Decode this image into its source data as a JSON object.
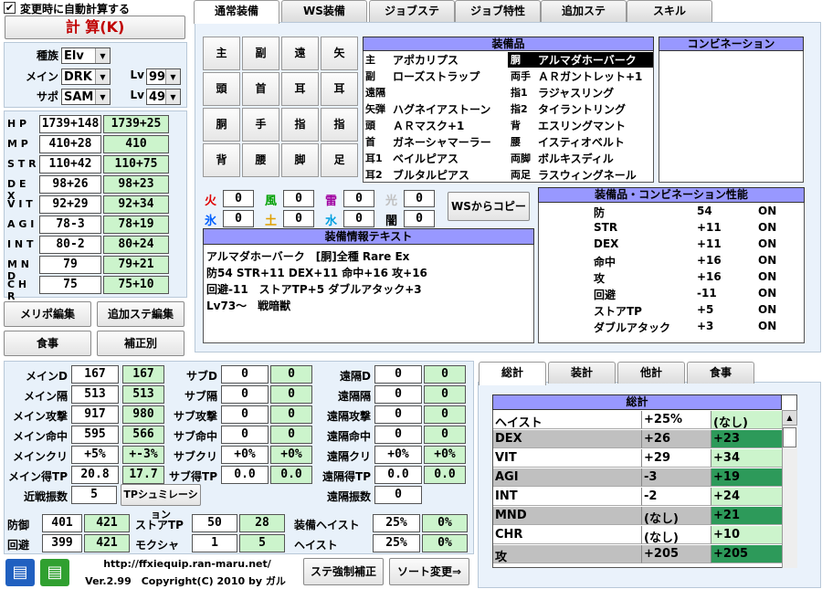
{
  "top": {
    "auto_calc_label": "変更時に自動計算する",
    "calc_button": "計 算(K)"
  },
  "race": {
    "label": "種族",
    "value": "Elv",
    "main_label": "メイン",
    "main_value": "DRK",
    "main_lv_label": "Lv",
    "main_lv": "99",
    "sub_label": "サポ",
    "sub_value": "SAM",
    "sub_lv_label": "Lv",
    "sub_lv": "49"
  },
  "stats": [
    {
      "name": "H P",
      "base": "1739+148",
      "total": "1739+25"
    },
    {
      "name": "M P",
      "base": "410+28",
      "total": "410"
    },
    {
      "name": "S T R",
      "base": "110+42",
      "total": "110+75"
    },
    {
      "name": "D E X",
      "base": "98+26",
      "total": "98+23"
    },
    {
      "name": "V I T",
      "base": "92+29",
      "total": "92+34"
    },
    {
      "name": "A G I",
      "base": "78-3",
      "total": "78+19"
    },
    {
      "name": "I N T",
      "base": "80-2",
      "total": "80+24"
    },
    {
      "name": "M N D",
      "base": "79",
      "total": "79+21"
    },
    {
      "name": "C H R",
      "base": "75",
      "total": "75+10"
    }
  ],
  "left_buttons": {
    "merit": "メリポ編集",
    "extra_stats": "追加ステ編集",
    "food": "食事",
    "correction": "補正別"
  },
  "tabs": [
    "通常装備",
    "WS装備",
    "ジョブステ",
    "ジョブ特性",
    "追加ステ",
    "スキル"
  ],
  "slots": [
    [
      "主",
      "副",
      "遠",
      "矢"
    ],
    [
      "頭",
      "首",
      "耳",
      "耳"
    ],
    [
      "胴",
      "手",
      "指",
      "指"
    ],
    [
      "背",
      "腰",
      "脚",
      "足"
    ]
  ],
  "equipment": {
    "header": "装備品",
    "left": [
      {
        "slot": "主",
        "name": "アポカリプス"
      },
      {
        "slot": "副",
        "name": "ローズストラップ"
      },
      {
        "slot": "遠隔",
        "name": ""
      },
      {
        "slot": "矢弾",
        "name": "ハグネイアストーン"
      },
      {
        "slot": "頭",
        "name": "ＡＲマスク+1"
      },
      {
        "slot": "首",
        "name": "ガネーシャマーラー"
      },
      {
        "slot": "耳1",
        "name": "ベイルピアス"
      },
      {
        "slot": "耳2",
        "name": "ブルタルピアス"
      }
    ],
    "right": [
      {
        "slot": "胴",
        "name": "アルマダホーバーク"
      },
      {
        "slot": "両手",
        "name": "ＡＲガントレット+1"
      },
      {
        "slot": "指1",
        "name": "ラジャスリング"
      },
      {
        "slot": "指2",
        "name": "タイラントリング"
      },
      {
        "slot": "背",
        "name": "エスリングマント"
      },
      {
        "slot": "腰",
        "name": "イスティオベルト"
      },
      {
        "slot": "両脚",
        "name": "ボルキスディル"
      },
      {
        "slot": "両足",
        "name": "ラスウィングネール"
      }
    ]
  },
  "combination": {
    "header": "コンビネーション"
  },
  "elements": [
    {
      "name": "火",
      "value": "0",
      "color": "#e00000"
    },
    {
      "name": "風",
      "value": "0",
      "color": "#00a000"
    },
    {
      "name": "雷",
      "value": "0",
      "color": "#a000a0"
    },
    {
      "name": "光",
      "value": "0",
      "color": "#c0c0c0"
    },
    {
      "name": "氷",
      "value": "0",
      "color": "#0060ff"
    },
    {
      "name": "土",
      "value": "0",
      "color": "#e0a000"
    },
    {
      "name": "水",
      "value": "0",
      "color": "#00a0e0"
    },
    {
      "name": "闇",
      "value": "0",
      "color": "#000000"
    }
  ],
  "ws_copy": "WSからコピー",
  "equip_text": {
    "header": "装備情報テキスト",
    "lines": [
      "アルマダホーバーク　[胴]全種 Rare Ex",
      "防54 STR+11 DEX+11 命中+16 攻+16",
      "回避-11　ストアTP+5 ダブルアタック+3",
      "Lv73～　戦暗獣"
    ]
  },
  "perf": {
    "header": "装備品・コンビネーション性能",
    "rows": [
      {
        "name": "防",
        "value": "54",
        "state": "ON"
      },
      {
        "name": "STR",
        "value": "+11",
        "state": "ON"
      },
      {
        "name": "DEX",
        "value": "+11",
        "state": "ON"
      },
      {
        "name": "命中",
        "value": "+16",
        "state": "ON"
      },
      {
        "name": "攻",
        "value": "+16",
        "state": "ON"
      },
      {
        "name": "回避",
        "value": "-11",
        "state": "ON"
      },
      {
        "name": "ストアTP",
        "value": "+5",
        "state": "ON"
      },
      {
        "name": "ダブルアタック",
        "value": "+3",
        "state": "ON"
      }
    ]
  },
  "battle": {
    "main": [
      {
        "label": "メインD",
        "a": "167",
        "b": "167"
      },
      {
        "label": "メイン隔",
        "a": "513",
        "b": "513"
      },
      {
        "label": "メイン攻撃",
        "a": "917",
        "b": "980"
      },
      {
        "label": "メイン命中",
        "a": "595",
        "b": "566"
      },
      {
        "label": "メインクリ",
        "a": "+5%",
        "b": "+-3%"
      },
      {
        "label": "メイン得TP",
        "a": "20.8",
        "b": "17.7"
      }
    ],
    "sub": [
      {
        "label": "サブD",
        "a": "0",
        "b": "0"
      },
      {
        "label": "サブ隔",
        "a": "0",
        "b": "0"
      },
      {
        "label": "サブ攻撃",
        "a": "0",
        "b": "0"
      },
      {
        "label": "サブ命中",
        "a": "0",
        "b": "0"
      },
      {
        "label": "サブクリ",
        "a": "+0%",
        "b": "+0%"
      },
      {
        "label": "サブ得TP",
        "a": "0.0",
        "b": "0.0"
      }
    ],
    "ranged": [
      {
        "label": "遠隔D",
        "a": "0",
        "b": "0"
      },
      {
        "label": "遠隔隔",
        "a": "0",
        "b": "0"
      },
      {
        "label": "遠隔攻撃",
        "a": "0",
        "b": "0"
      },
      {
        "label": "遠隔命中",
        "a": "0",
        "b": "0"
      },
      {
        "label": "遠隔クリ",
        "a": "+0%",
        "b": "+0%"
      },
      {
        "label": "遠隔得TP",
        "a": "0.0",
        "b": "0.0"
      }
    ],
    "melee_hits_label": "近戦振数",
    "melee_hits": "5",
    "tp_sim": "TPシュミレーション",
    "ranged_hits_label": "遠隔振数",
    "ranged_hits": "0",
    "def_label": "防御",
    "def_a": "401",
    "def_b": "421",
    "eva_label": "回避",
    "eva_a": "399",
    "eva_b": "421",
    "stp_label": "ストアTP",
    "stp_a": "50",
    "stp_b": "28",
    "moku_label": "モクシャ",
    "moku_a": "1",
    "moku_b": "5",
    "ehaste_label": "装備ヘイスト",
    "ehaste_a": "25%",
    "ehaste_b": "0%",
    "haste_label": "ヘイスト",
    "haste_a": "25%",
    "haste_b": "0%"
  },
  "footer": {
    "url": "http://ffxiequip.ran-maru.net/",
    "version": "Ver.2.99　Copyright(C) 2010 by ガル",
    "stat_fix": "ステ強制補正",
    "sort": "ソート変更⇒"
  },
  "bottom_tabs": [
    "総計",
    "装計",
    "他計",
    "食事"
  ],
  "total": {
    "header": "総計",
    "rows": [
      {
        "name": "ヘイスト",
        "a": "+25%",
        "b": "(なし)",
        "shade": false
      },
      {
        "name": "DEX",
        "a": "+26",
        "b": "+23",
        "shade": true
      },
      {
        "name": "VIT",
        "a": "+29",
        "b": "+34",
        "shade": false
      },
      {
        "name": "AGI",
        "a": "-3",
        "b": "+19",
        "shade": true
      },
      {
        "name": "INT",
        "a": "-2",
        "b": "+24",
        "shade": false
      },
      {
        "name": "MND",
        "a": "(なし)",
        "b": "+21",
        "shade": true
      },
      {
        "name": "CHR",
        "a": "(なし)",
        "b": "+10",
        "shade": false
      },
      {
        "name": "攻",
        "a": "+205",
        "b": "+205",
        "shade": true
      }
    ]
  }
}
